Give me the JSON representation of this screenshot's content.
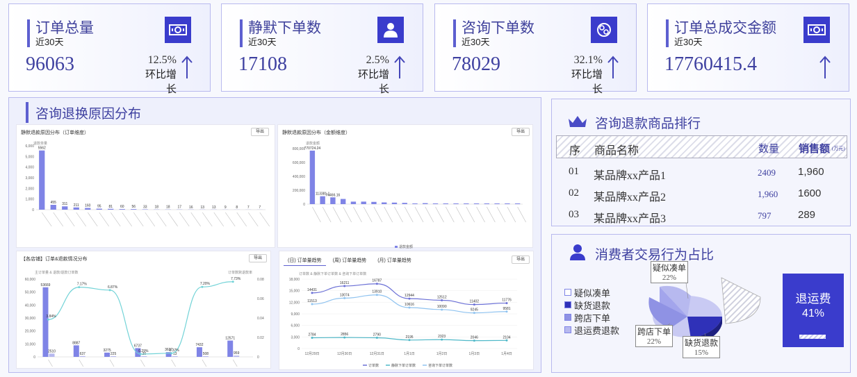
{
  "cards": [
    {
      "title": "订单总量",
      "sub": "近30天",
      "value": "96063",
      "pct": "12.5%",
      "growth": "环比增长",
      "icon": "money-icon"
    },
    {
      "title": "静默下单数",
      "sub": "近30天",
      "value": "17108",
      "pct": "2.5%",
      "growth": "环比增长",
      "icon": "user-icon"
    },
    {
      "title": "咨询下单数",
      "sub": "近30天",
      "value": "78029",
      "pct": "32.1%",
      "growth": "环比增长",
      "icon": "chat-icon"
    },
    {
      "title": "订单总成交金额",
      "sub": "近30天",
      "value": "17760415.4",
      "pct": "",
      "growth": "",
      "icon": "money-icon"
    }
  ],
  "reason_panel": {
    "title": "咨询退换原因分布",
    "export": "导出"
  },
  "chart1": {
    "title": "静默退款原因分布（订单维度）",
    "unit": "退款单量"
  },
  "chart2": {
    "title": "静默退款原因分布（金额维度）",
    "unit": "退款金额"
  },
  "chart3": {
    "title": "【各店铺】订单&退款情况分布",
    "left_unit": "主订单量 & 退款/退款订单数",
    "right_unit": "订单数默退款率"
  },
  "chart4": {
    "tabs": [
      "(日) 订单量趋势",
      "(周) 订单量趋势",
      "(月) 订单量趋势"
    ],
    "unit": "订单数 & 静默下单订单数 & 咨询下单订单数"
  },
  "ranking": {
    "title": "咨询退款商品排行",
    "headers": {
      "rank": "序",
      "name": "商品名称",
      "qty": "数量",
      "sales": "销售额",
      "sales_unit": "(万元)"
    },
    "rows": [
      {
        "rank": "01",
        "name": "某品牌xx产品1",
        "qty": "2409",
        "sales": "1,960"
      },
      {
        "rank": "02",
        "name": "某品牌xx产品2",
        "qty": "1,960",
        "sales": "1600"
      },
      {
        "rank": "03",
        "name": "某品牌xx产品3",
        "qty": "797",
        "sales": "289"
      }
    ]
  },
  "behavior": {
    "title": "消费者交易行为占比",
    "legend": [
      "疑似凑单",
      "缺货退款",
      "跨店下单",
      "退运费退款"
    ],
    "callouts": [
      {
        "label": "疑似凑单",
        "pct": "22%"
      },
      {
        "label": "跨店下单",
        "pct": "22%"
      },
      {
        "label": "缺货退款",
        "pct": "15%"
      }
    ],
    "highlight": {
      "label": "退运费",
      "pct": "41%"
    }
  },
  "chart_data": [
    {
      "type": "bar",
      "title": "静默退款原因分布（订单维度）",
      "ylabel": "退款单量",
      "ylim": [
        0,
        6000
      ],
      "yticks": [
        "6,000",
        "5,000",
        "4,000",
        "3,000",
        "2,000",
        "1,000",
        "0"
      ],
      "values": [
        5562,
        455,
        311,
        211,
        160,
        95,
        81,
        60,
        56,
        33,
        18,
        18,
        17,
        16,
        13,
        13,
        9,
        8,
        7,
        7
      ],
      "labels": [
        "5562",
        "455",
        "311",
        "211",
        "160",
        "95",
        "81",
        "60",
        "56",
        "33",
        "18",
        "18",
        "17",
        "16",
        "13",
        "13",
        "9",
        "8",
        "7",
        "7"
      ],
      "color": "#7f84e6"
    },
    {
      "type": "bar",
      "title": "静默退款原因分布（金额维度）",
      "ylabel": "退款金额",
      "ylim": [
        0,
        800000
      ],
      "yticks": [
        "800,000",
        "600,000",
        "400,000",
        "200,000",
        "0"
      ],
      "values": [
        770724.2,
        113381.1,
        97463.2,
        74466.2,
        35756.1,
        36082.1,
        32307.1,
        24524.6,
        21779.1,
        18003.1,
        7518.1,
        13986.1,
        6297.1,
        3932.5,
        3956.1,
        9653.5,
        1556,
        1206,
        1067.1,
        6907.1,
        7906.1
      ],
      "top_labels": [
        "770724.24",
        "113381.1",
        "74466.16"
      ],
      "legend": "退款金额",
      "color": "#7f84e6"
    },
    {
      "type": "bar",
      "title": "【各店铺】订单&退款情况分布",
      "ylim": [
        0,
        60000
      ],
      "yticks": [
        "60,000",
        "50,000",
        "40,000",
        "30,000",
        "20,000",
        "10,000",
        "0"
      ],
      "y2ticks": [
        "0.08",
        "0.06",
        "0.04",
        "0.02",
        "0"
      ],
      "series": [
        {
          "name": "主订单量",
          "values": [
            53669,
            8887,
            3275,
            6737,
            3637,
            7432,
            12571
          ],
          "labels": [
            "53669",
            "8887",
            "3275",
            "6737",
            "3637",
            "7432",
            "12571"
          ]
        },
        {
          "name": "退款订单数",
          "values": [
            2510,
            637,
            225,
            20,
            13,
            508,
            959
          ],
          "labels": [
            "2510",
            "637",
            "225",
            "20",
            "13",
            "508",
            "959"
          ]
        }
      ],
      "rate": {
        "values": [
          3.84,
          7.17,
          6.87,
          0.29,
          0.37,
          7.2,
          7.73
        ],
        "labels": [
          "3.84%",
          "7.17%",
          "6.87%",
          "0.29%",
          "0.37%",
          "7.20%",
          "7.73%"
        ]
      }
    },
    {
      "type": "line",
      "ylim": [
        0,
        18000
      ],
      "yticks": [
        "18,000",
        "15,000",
        "12,000",
        "9,000",
        "6,000",
        "3,000",
        "0"
      ],
      "categories": [
        "12月29日",
        "12月30日",
        "12月31日",
        "1月1日",
        "1月2日",
        "1月3日",
        "1月4日"
      ],
      "series": [
        {
          "name": "订单数",
          "values": [
            14431,
            16211,
            16787,
            12944,
            12512,
            11402,
            11776
          ],
          "color": "#6b70d6"
        },
        {
          "name": "静默下单订单数",
          "values": [
            2784,
            2856,
            2790,
            2195,
            2323,
            2046,
            2104
          ],
          "color": "#4fb8c8"
        },
        {
          "name": "咨询下单订单数",
          "values": [
            11513,
            13074,
            13910,
            10616,
            10090,
            9245,
            9581
          ],
          "color": "#8fc3f0"
        }
      ]
    }
  ]
}
